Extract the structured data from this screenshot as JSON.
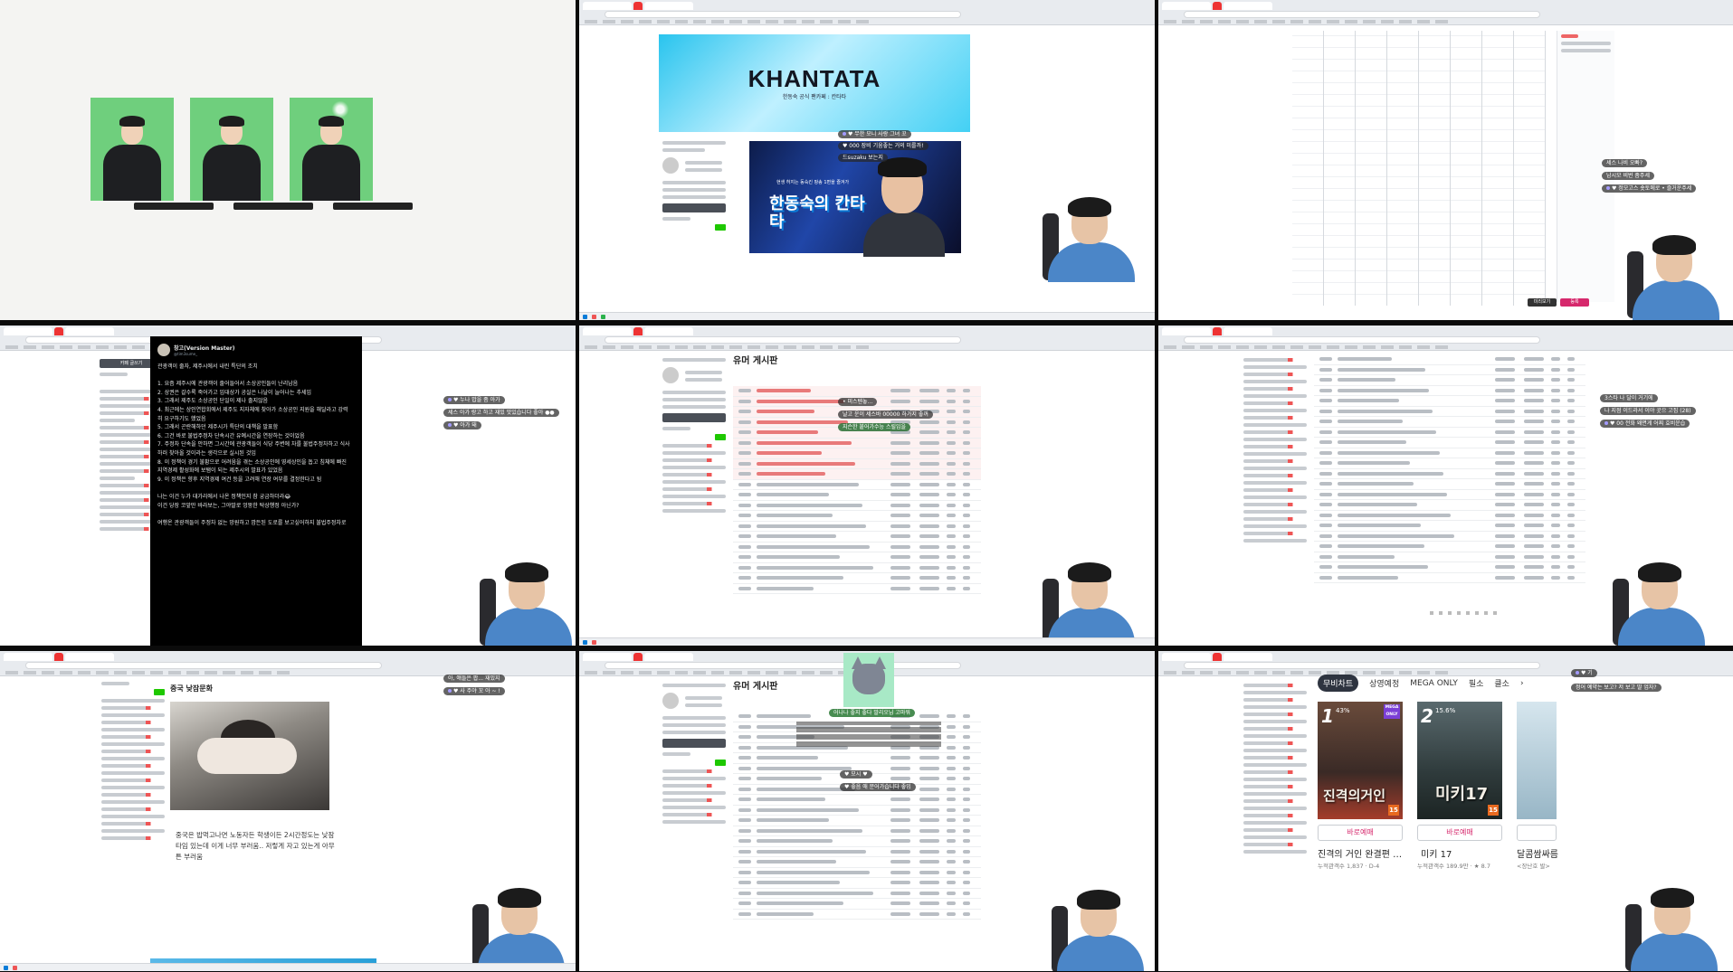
{
  "panel2": {
    "banner_title": "KHANTATA",
    "banner_sub": "한동숙 공식 팬카페 : 칸타타",
    "video_top": "현생 허지는 동숙킨 팡송 1편을 즐겨가",
    "video_title": "한동숙의 칸타타",
    "chats": [
      "♥ 무한 모니 사랑 그녀 꼬",
      "♥ 000 장비 기움좋는 거의 미를까!",
      "드suzaku 보는지"
    ]
  },
  "panel3": {
    "chats": [
      "세스 나비 오빠?",
      "남시모 비번 좀주세",
      "♥ 정모고스 숏토메로 • 즐거운주세"
    ],
    "buttons": [
      "미리보기",
      "등록"
    ]
  },
  "panel4": {
    "tweet": {
      "name": "창고(Version Master)",
      "handle": "@tim3sume_",
      "lines": [
        "관광객이 줄자, 제주시에서 내린 특단의 조치",
        "",
        "1. 요즘 제주시에 관광객이 줄어들어서 소상공인들이 난리남음",
        "2. 상권은 갈수록 죽어가고 임대상가 공실은 나날이 늘어나는 추세임",
        "3. 그래서 제주도 소상공인 단일이 제나 출지않음",
        "4. 최근에는 상인연합회에서 제주도 지자체에 찾아가 소상공인 지원을 해달라고 강력",
        "히 요구하기도 했었음",
        "5. 그래서 곤란해하던 제주시가 특단의 대책을 발표함",
        "6. 그건 바로 불법주정차 단속시간 유예시간을 연장하는 것이었음",
        "7. 주정차 단속을 안하면 그시간에 관광객들이 식당 주변에 차를 불법주정차하고 식사",
        "하러 찾아올 것이라는 생각으로 실시된 것임",
        "8. 이 정책이 경기 불황으로 어려움을 겪는 소상공인에 영세상인을 돕고 침체에 빠진",
        "지역경제 활성화에 보탬이 되는 제주시의 발표가 있었음",
        "9. 이 정책은 향후 지역경제 여건 등을 고려해 연장 여부를 결정한다고 됨",
        "",
        "나는 이건 누가 대가리에서 나온 정책인지 참 궁금하더라😂",
        "이건 당장 코앞만 바라보는, 그야말로 엉뚱한 탁상행정 아닌가?",
        "",
        "여행온 관광객들이 주정차 없는 망원하고 깜든된 도로를 보고싶어하지 불법주정차로"
      ]
    },
    "chats": [
      "♥ 누나 밥을 좀 아가",
      "세스 아가 랑고 하고 재밌 맛있습니다 좋아 ●●",
      "♥ 아가 돼"
    ],
    "sidebar_btn": "카페 글쓰기"
  },
  "panel5": {
    "board_title": "유머 게시판",
    "chats": [
      "• 미스텐놓...",
      "날고 운이 세스바 00000 하가지 좋꺼",
      "지슨한 붙어가수능 스릴임을"
    ]
  },
  "panel6": {
    "chats": [
      "3스타 나 달이 거기에",
      "나 지점 이드라서 이야 곳으 고집 (28)",
      "♥ 00 전화 왜면게 어찌 효비운습"
    ]
  },
  "panel7": {
    "heading": "중국 낮잠문화",
    "text": "중국은 밥먹고나면 노동자든 학생이든 2시간정도는 낮잠타임 있는데 이게 너무 부러움.. 저렇게 자고 있는게 아무튼 부러움",
    "chats": [
      "아, 얘들은 팝... 재밌지",
      "♥ 사 주야 꼬 아 ~ !"
    ]
  },
  "panel8": {
    "board_title": "유머 게시판",
    "chats": [
      "어나나 좋지 좋다 말리오님 고마워",
      "♥ 모시 ♥",
      "♥ 좋음 애 문어가습니다 좋임"
    ]
  },
  "panel9": {
    "tabs": [
      "무비차트",
      "상영예정",
      "MEGA ONLY",
      "필소",
      "클소"
    ],
    "chevron": "›",
    "movies": [
      {
        "rank": "1",
        "pct": "43%",
        "title_on_poster": "진격의거인",
        "age": "15",
        "mega": "MEGA ONLY",
        "reserve": "바로예매",
        "name": "진격의 거인 완결편 …",
        "meta": "누적관객수 1,837 · D-4"
      },
      {
        "rank": "2",
        "pct": "15.6%",
        "title_on_poster": "미키17",
        "age": "15",
        "mega": "",
        "reserve": "바로예매",
        "name": "미키 17",
        "meta": "누적관객수 189.9만 · ★ 8.7"
      },
      {
        "rank": "",
        "pct": "",
        "title_on_poster": "",
        "age": "",
        "mega": "",
        "reserve": "",
        "name": "달콤쌈싸름",
        "meta": "<장난호 발>"
      }
    ],
    "chats": [
      "♥ 기",
      "정어 예약는 보고? 저 보고 딸 업자?"
    ]
  },
  "colors": {
    "accent_green": "#1ec800",
    "chat_bg": "#282828",
    "hot_row": "#e87a7a",
    "brand_pink": "#d6286c"
  }
}
